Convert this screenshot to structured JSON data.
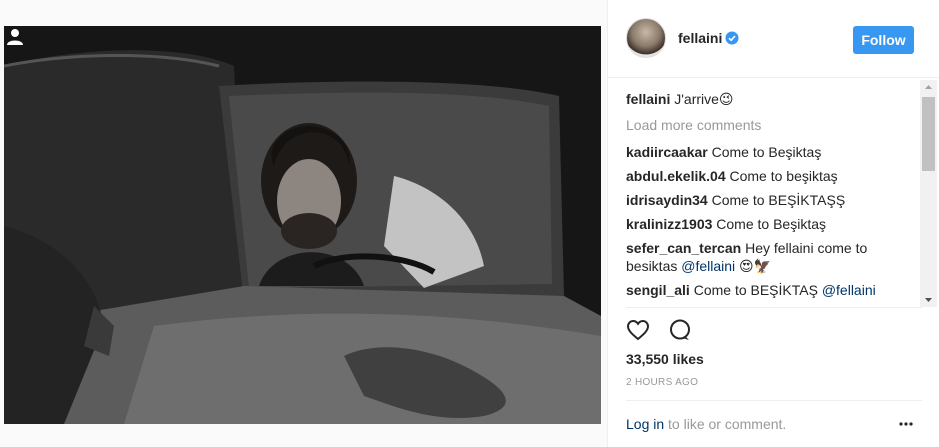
{
  "post": {
    "username": "fellaini",
    "follow_label": "Follow",
    "caption": {
      "author": "fellaini",
      "text": "J'arrive😉"
    },
    "load_more_label": "Load more comments",
    "comments": [
      {
        "author": "kadiircaakar",
        "text": "Come to Beşiktaş"
      },
      {
        "author": "abdul.ekelik.04",
        "text": "Come to beşiktaş"
      },
      {
        "author": "idrisaydin34",
        "text": "Come to BEŞİKTAŞŞ"
      },
      {
        "author": "kralinizz1903",
        "text": "Come to Beşiktaş"
      },
      {
        "author": "sefer_can_tercan",
        "text": "Hey fellaini come to besiktas ",
        "mention": "@fellaini",
        "suffix": " 😍🦅"
      },
      {
        "author": "sengil_ali",
        "text": "Come to BEŞİKTAŞ ",
        "mention": "@fellaini"
      }
    ],
    "likes": "33,550 likes",
    "timestamp": "2 HOURS AGO",
    "footer": {
      "login_label": "Log in",
      "rest": " to like or comment."
    }
  },
  "icons": {
    "verified": "verified-badge-icon",
    "heart": "heart-icon",
    "comment": "comment-bubble-icon",
    "more": "more-options-icon",
    "user_tag": "user-tag-icon"
  },
  "colors": {
    "accent": "#3897f0",
    "link": "#003569",
    "muted": "#999999"
  }
}
